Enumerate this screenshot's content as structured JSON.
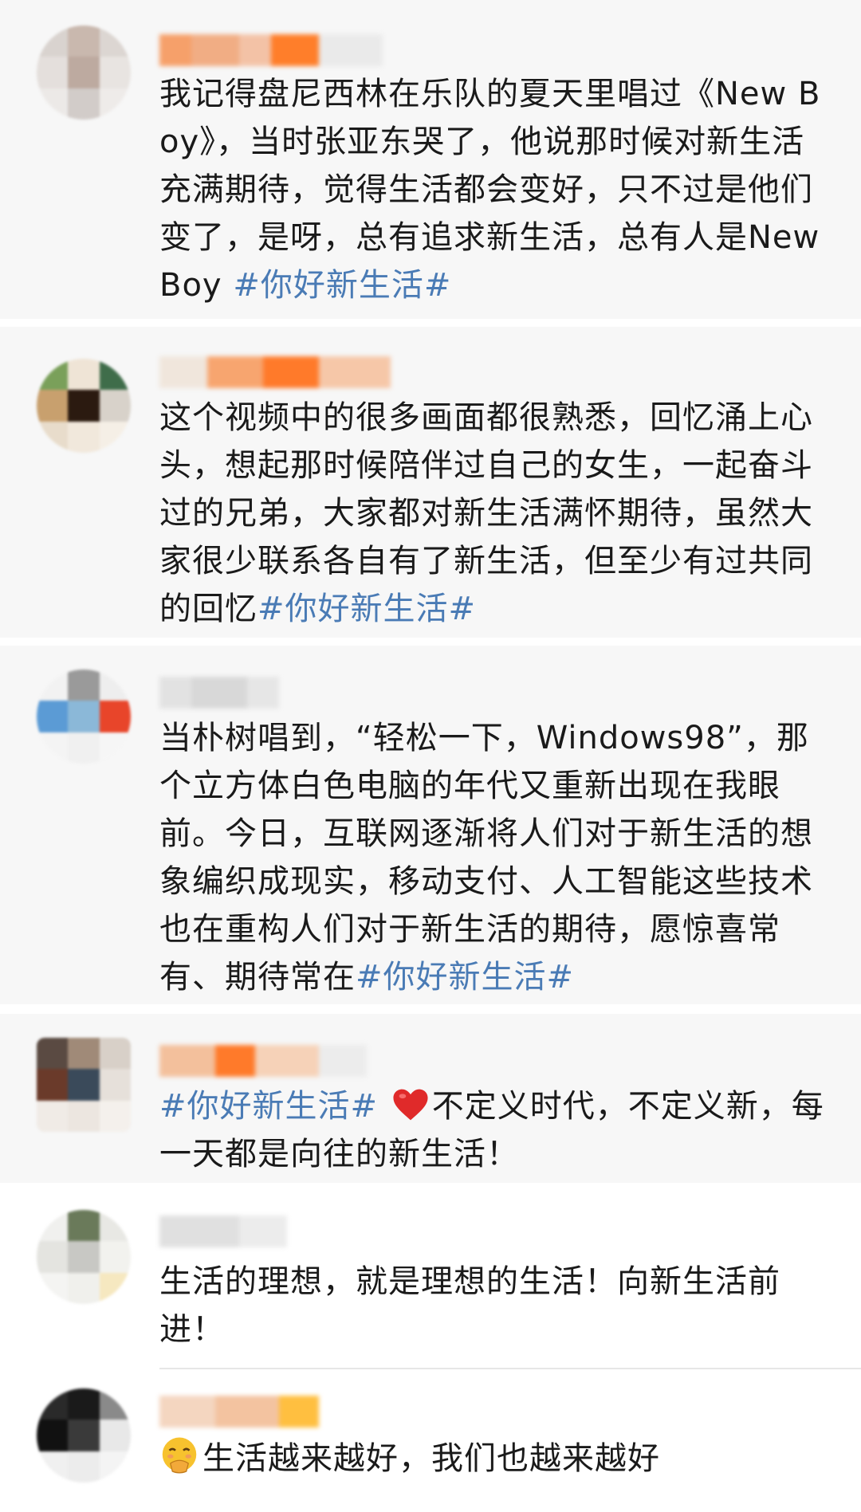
{
  "comments": [
    {
      "text": "我记得盘尼西林在乐队的夏天里唱过《New Boy》，当时张亚东哭了，他说那时候对新生活充满期待，觉得生活都会变好，只不过是他们变了，是呀，总有追求新生活，总有人是New Boy ",
      "hashtag": "#你好新生活#"
    },
    {
      "text": "这个视频中的很多画面都很熟悉，回忆涌上心头，想起那时候陪伴过自己的女生，一起奋斗过的兄弟，大家都对新生活满怀期待，虽然大家很少联系各自有了新生活，但至少有过共同的回忆",
      "hashtag": "#你好新生活#"
    },
    {
      "text": "当朴树唱到，“轻松一下，Windows98”，那个立方体白色电脑的年代又重新出现在我眼前。今日，互联网逐渐将人们对于新生活的想象编织成现实，移动支付、人工智能这些技术也在重构人们对于新生活的期待，愿惊喜常有、期待常在",
      "hashtag": "#你好新生活#"
    },
    {
      "hashtag": "#你好新生活#",
      "text": "不定义时代，不定义新，每一天都是向往的新生活！",
      "icon": "red-heart-icon"
    },
    {
      "text": "生活的理想，就是理想的生活！向新生活前进！"
    },
    {
      "text": "生活越来越好，我们也越来越好",
      "icon": "hand-over-mouth-emoji-icon"
    }
  ],
  "colors": {
    "hashtag": "#4a7bb5",
    "heart": "#e02a2a",
    "card_background": "#f7f7f7"
  }
}
